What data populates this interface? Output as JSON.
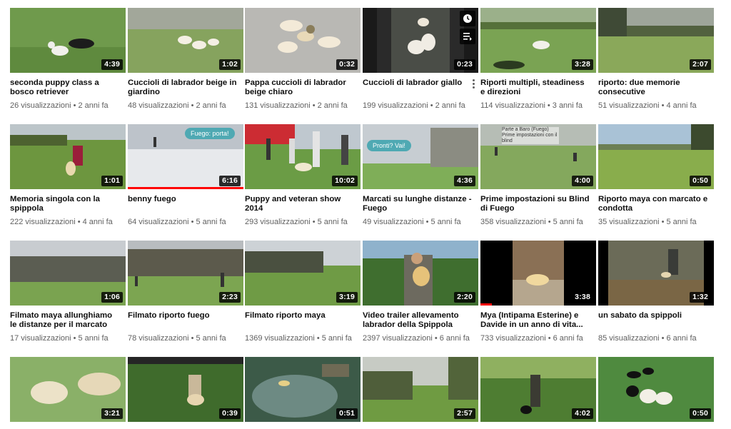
{
  "videos": [
    {
      "title": "seconda puppy class a bosco retriever",
      "duration": "4:39",
      "views": "26 visualizzazioni",
      "age": "2 anni fa"
    },
    {
      "title": "Cuccioli di labrador beige in giardino",
      "duration": "1:02",
      "views": "48 visualizzazioni",
      "age": "2 anni fa"
    },
    {
      "title": "Pappa cuccioli di labrador beige chiaro",
      "duration": "0:32",
      "views": "131 visualizzazioni",
      "age": "2 anni fa"
    },
    {
      "title": "Cuccioli di labrador giallo",
      "duration": "0:23",
      "views": "199 visualizzazioni",
      "age": "2 anni fa"
    },
    {
      "title": "Riporti multipli, steadiness e direzioni",
      "duration": "3:28",
      "views": "114 visualizzazioni",
      "age": "3 anni fa"
    },
    {
      "title": "riporto: due memorie consecutive",
      "duration": "2:07",
      "views": "51 visualizzazioni",
      "age": "4 anni fa"
    },
    {
      "title": "Memoria singola con la spippola",
      "duration": "1:01",
      "views": "222 visualizzazioni",
      "age": "4 anni fa"
    },
    {
      "title": "benny fuego",
      "duration": "6:16",
      "views": "64 visualizzazioni",
      "age": "5 anni fa",
      "overlay": "Fuego: porta!"
    },
    {
      "title": "Puppy and veteran show 2014",
      "duration": "10:02",
      "views": "293 visualizzazioni",
      "age": "5 anni fa"
    },
    {
      "title": "Marcati su lunghe distanze - Fuego",
      "duration": "4:36",
      "views": "49 visualizzazioni",
      "age": "5 anni fa",
      "overlay": "Pronti?  Vai!"
    },
    {
      "title": "Prime impostazioni su Blind di Fuego",
      "duration": "4:00",
      "views": "358 visualizzazioni",
      "age": "5 anni fa",
      "overlay": "Parte a Baro (Fuego) Prime impostazioni con il blind"
    },
    {
      "title": "Riporto maya con marcato e condotta",
      "duration": "0:50",
      "views": "35 visualizzazioni",
      "age": "5 anni fa"
    },
    {
      "title": "Filmato maya allunghiamo le distanze per il marcato",
      "duration": "1:06",
      "views": "17 visualizzazioni",
      "age": "5 anni fa"
    },
    {
      "title": "Filmato riporto fuego",
      "duration": "2:23",
      "views": "78 visualizzazioni",
      "age": "5 anni fa"
    },
    {
      "title": "Filmato riporto maya",
      "duration": "3:19",
      "views": "1369 visualizzazioni",
      "age": "5 anni fa"
    },
    {
      "title": "Video trailer allevamento labrador della Spippola",
      "duration": "2:20",
      "views": "2397 visualizzazioni",
      "age": "6 anni fa"
    },
    {
      "title": "Mya (Intipama Esterine) e Davide in un anno di vita...",
      "duration": "3:38",
      "views": "733 visualizzazioni",
      "age": "6 anni fa"
    },
    {
      "title": "un sabato da spippoli",
      "duration": "1:32",
      "views": "85 visualizzazioni",
      "age": "6 anni fa"
    },
    {
      "title": "",
      "duration": "3:21",
      "views": "",
      "age": ""
    },
    {
      "title": "",
      "duration": "0:39",
      "views": "",
      "age": ""
    },
    {
      "title": "",
      "duration": "0:51",
      "views": "",
      "age": ""
    },
    {
      "title": "",
      "duration": "2:57",
      "views": "",
      "age": ""
    },
    {
      "title": "",
      "duration": "4:02",
      "views": "",
      "age": ""
    },
    {
      "title": "",
      "duration": "0:50",
      "views": "",
      "age": ""
    }
  ],
  "icons": {
    "watch_later": "clock-icon",
    "add_to_queue": "queue-icon",
    "more": "more-vert-icon"
  },
  "colors": {
    "progress": "#ff0000",
    "meta_text": "#606060",
    "duration_bg": "#000000"
  }
}
